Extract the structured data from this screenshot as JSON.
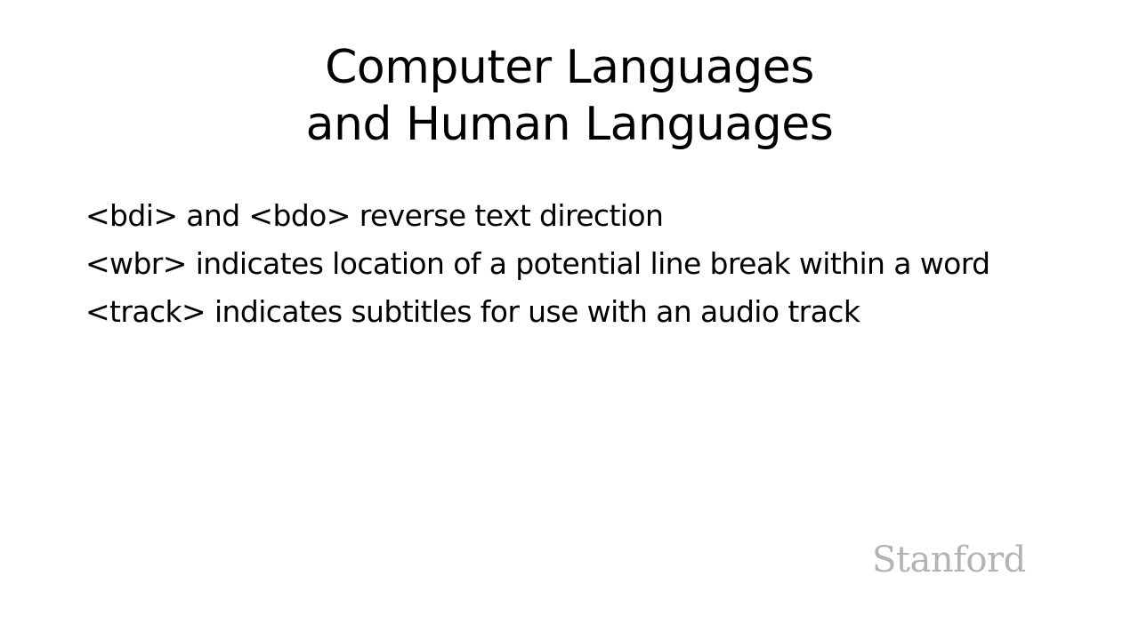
{
  "slide": {
    "title_lines": [
      "Computer Languages",
      "and Human Languages"
    ],
    "bullets": [
      "<bdi> and <bdo> reverse text direction",
      "<wbr> indicates location of a potential line break within a word",
      "<track> indicates subtitles for use with an audio track"
    ],
    "logo_text": "Stanford"
  },
  "colors": {
    "background": "#ffffff",
    "text": "#000000",
    "logo": "#b3b3b3"
  }
}
